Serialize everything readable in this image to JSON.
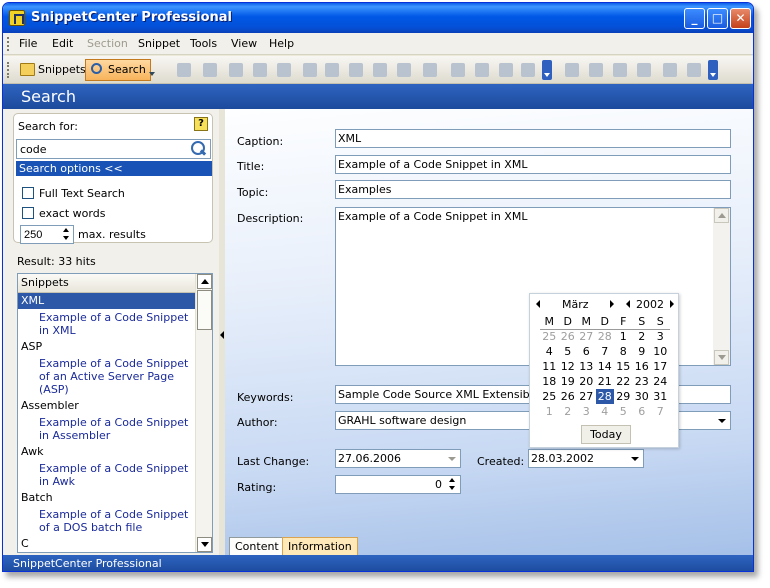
{
  "window": {
    "title": "SnippetCenter Professional"
  },
  "menu": [
    "File",
    "Edit",
    "Section",
    "Snippet",
    "Tools",
    "View",
    "Help"
  ],
  "toolbar": {
    "snippets_label": "Snippets",
    "search_label": "Search"
  },
  "section_title": "Search",
  "search": {
    "label": "Search for:",
    "help": "?",
    "query": "code",
    "options_label": "Search options <<",
    "full_text_label": "Full Text Search",
    "exact_words_label": "exact words",
    "max_results_value": "250",
    "max_results_label": "max. results"
  },
  "result": {
    "label": "Result: 33 hits",
    "column_header": "Snippets",
    "categories": [
      {
        "name": "XML",
        "items": [
          "Example of a Code Snippet in XML"
        ]
      },
      {
        "name": "ASP",
        "items": [
          "Example of a Code Snippet of an Active Server Page (ASP)"
        ]
      },
      {
        "name": "Assembler",
        "items": [
          "Example of a Code Snippet in Assembler"
        ]
      },
      {
        "name": "Awk",
        "items": [
          "Example of a Code Snippet in Awk"
        ]
      },
      {
        "name": "Batch",
        "items": [
          "Example of a Code Snippet of a DOS batch file"
        ]
      },
      {
        "name": "C",
        "items": []
      }
    ]
  },
  "form": {
    "caption_label": "Caption:",
    "caption": "XML",
    "title_label": "Title:",
    "title": "Example of a Code Snippet in XML",
    "topic_label": "Topic:",
    "topic": "Examples",
    "description_label": "Description:",
    "description": "Example of a Code Snippet in XML",
    "keywords_label": "Keywords:",
    "keywords": "Sample Code Source XML Extensible Ma",
    "author_label": "Author:",
    "author": "GRAHL software design",
    "last_change_label": "Last Change:",
    "last_change": "27.06.2006",
    "created_label": "Created:",
    "created": "28.03.2002",
    "rating_label": "Rating:",
    "rating": "0"
  },
  "calendar": {
    "month": "März",
    "year": "2002",
    "weekdays": [
      "M",
      "D",
      "M",
      "D",
      "F",
      "S",
      "S"
    ],
    "weeks": [
      [
        "25",
        "26",
        "27",
        "28",
        "1",
        "2",
        "3"
      ],
      [
        "4",
        "5",
        "6",
        "7",
        "8",
        "9",
        "10"
      ],
      [
        "11",
        "12",
        "13",
        "14",
        "15",
        "16",
        "17"
      ],
      [
        "18",
        "19",
        "20",
        "21",
        "22",
        "23",
        "24"
      ],
      [
        "25",
        "26",
        "27",
        "28",
        "29",
        "30",
        "31"
      ],
      [
        "1",
        "2",
        "3",
        "4",
        "5",
        "6",
        "7"
      ]
    ],
    "selected": "28",
    "today_label": "Today"
  },
  "tabs": {
    "content": "Content",
    "information": "Information"
  },
  "status": "SnippetCenter Professional"
}
